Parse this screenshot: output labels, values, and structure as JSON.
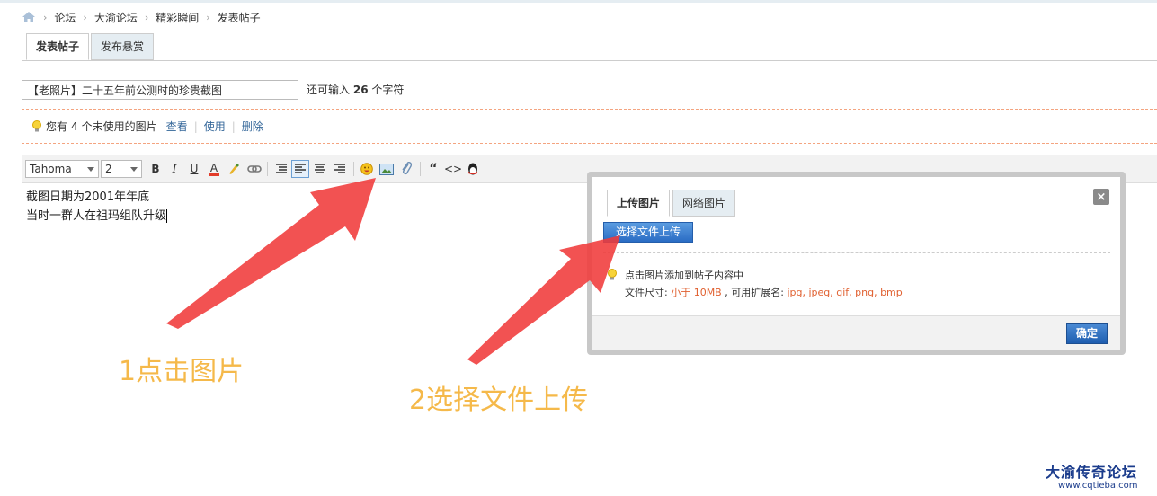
{
  "breadcrumb": {
    "items": [
      "论坛",
      "大渝论坛",
      "精彩瞬间",
      "发表帖子"
    ],
    "separator": "›"
  },
  "tabs": [
    {
      "label": "发表帖子",
      "active": true
    },
    {
      "label": "发布悬赏",
      "active": false
    }
  ],
  "subject": {
    "value": "【老照片】二十五年前公测时的珍贵截图",
    "remain_prefix": "还可输入",
    "remain_count": "26",
    "remain_suffix": "个字符"
  },
  "notice": {
    "prefix": "您有",
    "count": "4",
    "suffix": "个未使用的图片",
    "links": [
      "查看",
      "使用",
      "删除"
    ]
  },
  "toolbar": {
    "font_family": "Tahoma",
    "font_size": "2",
    "bold": "B",
    "italic": "I",
    "underline": "U",
    "color": "A",
    "quote": "“",
    "code": "<>"
  },
  "editor": {
    "lines": [
      "截图日期为2001年年底",
      "当时一群人在祖玛组队升级"
    ]
  },
  "dialog": {
    "tabs": [
      {
        "label": "上传图片",
        "active": true
      },
      {
        "label": "网络图片",
        "active": false
      }
    ],
    "close_label": "×",
    "upload_button": "选择文件上传",
    "hint_line1": "点击图片添加到帖子内容中",
    "hint_size_prefix": "文件尺寸: ",
    "hint_size_value": "小于 10MB",
    "hint_ext_prefix": " , 可用扩展名: ",
    "hint_ext_value": "jpg, jpeg, gif, png, bmp",
    "ok_button": "确定"
  },
  "annotations": {
    "step1": "1点击图片",
    "step2": "2选择文件上传",
    "color": "#f5b94a",
    "arrow_color": "#f03a3a"
  },
  "watermark": {
    "title": "大渝传奇论坛",
    "url": "www.cqtieba.com"
  }
}
